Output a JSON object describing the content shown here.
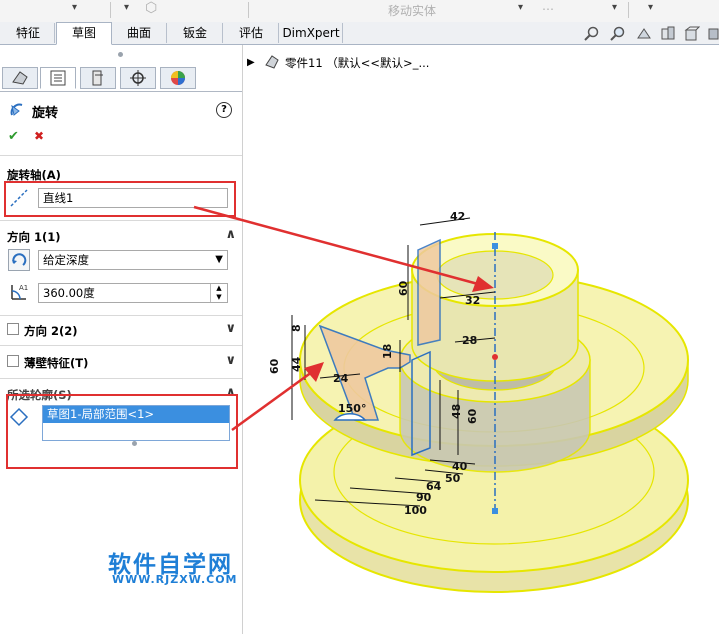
{
  "toolbar": {
    "move_entity": "移动实体"
  },
  "tabs": [
    {
      "label": "特征"
    },
    {
      "label": "草图"
    },
    {
      "label": "曲面"
    },
    {
      "label": "钣金"
    },
    {
      "label": "评估"
    },
    {
      "label": "DimXpert"
    }
  ],
  "active_tab": "草图",
  "feature": {
    "title": "旋转",
    "help": "?",
    "ok": "✔",
    "cancel": "✖"
  },
  "axis_section": {
    "title": "旋转轴(A)",
    "value": "直线1"
  },
  "direction1": {
    "title": "方向 1(1)",
    "type_value": "给定深度",
    "angle_value": "360.00度"
  },
  "direction2": {
    "title": "方向 2(2)"
  },
  "thin": {
    "title": "薄壁特征(T)"
  },
  "contours": {
    "title": "所选轮廓(S)",
    "item": "草图1-局部范围<1>"
  },
  "tree": {
    "label": "零件11 （默认<<默认>_..."
  },
  "dimensions": {
    "d42": "42",
    "d60a": "60",
    "d32": "32",
    "d8": "8",
    "d28": "28",
    "d60b": "60",
    "d44": "44",
    "d18": "18",
    "d24": "24",
    "d150": "150°",
    "d48": "48",
    "d60c": "60",
    "d40": "40",
    "d50": "50",
    "d64": "64",
    "d90": "90",
    "d100": "100"
  },
  "watermark": {
    "title": "软件自学网",
    "url": "WWW.RJZXW.COM"
  },
  "colors": {
    "accent_red": "#e03030",
    "selection_blue": "#3b8fe0",
    "watermark_blue": "#1f7fd6",
    "model_yellow": "#f4f28a"
  }
}
